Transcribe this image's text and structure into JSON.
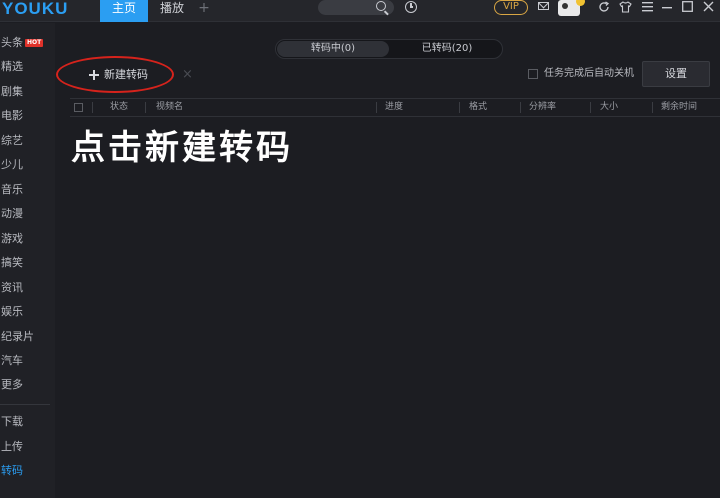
{
  "app": {
    "logo": "YOUKU"
  },
  "topbar": {
    "tabs": [
      {
        "label": "主页",
        "active": true
      },
      {
        "label": "播放",
        "active": false
      }
    ],
    "add_tab_label": "+",
    "vip_label": "VIP",
    "accent_color": "#2b9ef2",
    "icons": [
      "search-icon",
      "history-icon",
      "mail-icon",
      "refresh-icon",
      "skin-icon",
      "menu-icon",
      "minimize-icon",
      "maximize-icon",
      "close-icon"
    ]
  },
  "sidebar": {
    "items": [
      {
        "label": "头条",
        "badge": "HOT"
      },
      {
        "label": "精选"
      },
      {
        "label": "剧集"
      },
      {
        "label": "电影"
      },
      {
        "label": "综艺"
      },
      {
        "label": "少儿"
      },
      {
        "label": "音乐"
      },
      {
        "label": "动漫"
      },
      {
        "label": "游戏"
      },
      {
        "label": "搞笑"
      },
      {
        "label": "资讯"
      },
      {
        "label": "娱乐"
      },
      {
        "label": "纪录片"
      },
      {
        "label": "汽车"
      },
      {
        "label": "更多"
      }
    ],
    "bottom_items": [
      {
        "label": "下载"
      },
      {
        "label": "上传"
      },
      {
        "label": "转码",
        "active": true
      }
    ]
  },
  "main": {
    "segments": [
      {
        "label": "转码中(0)",
        "active": true
      },
      {
        "label": "已转码(20)",
        "active": false
      }
    ],
    "new_button_label": "新建转码",
    "delete_icon": "×",
    "auto_shutdown_label": "任务完成后自动关机",
    "settings_label": "设置",
    "columns": [
      "状态",
      "视频名",
      "进度",
      "格式",
      "分辨率",
      "大小",
      "剩余时间"
    ],
    "hint_text": "点击新建转码"
  }
}
